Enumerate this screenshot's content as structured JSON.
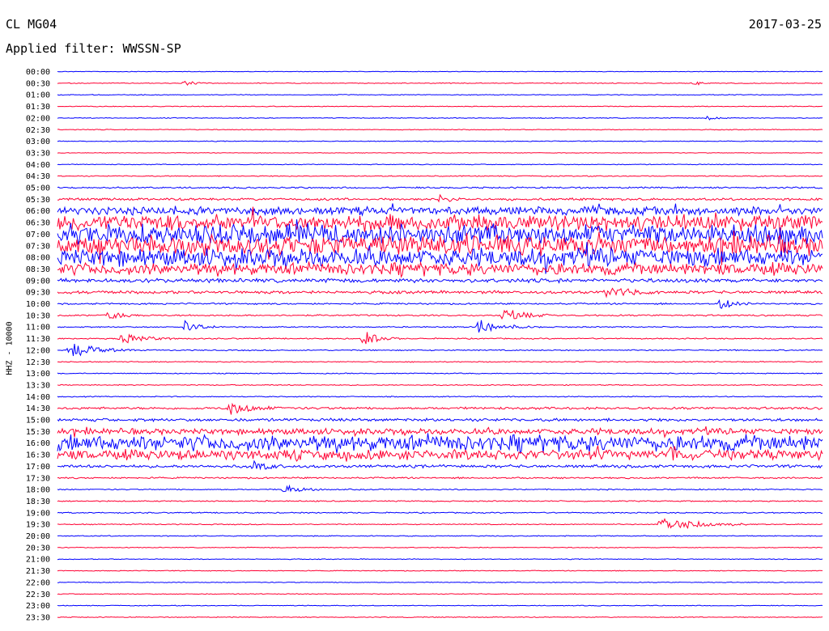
{
  "header": {
    "station": "CL MG04",
    "date": "2017-03-25",
    "filter": "Applied filter: WWSSN-SP"
  },
  "channel_label": "HHZ - 10000",
  "colors": {
    "blue": "#0000ff",
    "red": "#ff0033",
    "text": "#000000"
  },
  "chart_data": {
    "type": "line",
    "title": "",
    "ylabel": "HHZ - 10000",
    "rows": [
      "00:00",
      "00:30",
      "01:00",
      "01:30",
      "02:00",
      "02:30",
      "03:00",
      "03:30",
      "04:00",
      "04:30",
      "05:00",
      "05:30",
      "06:00",
      "06:30",
      "07:00",
      "07:30",
      "08:00",
      "08:30",
      "09:00",
      "09:30",
      "10:00",
      "10:30",
      "11:00",
      "11:30",
      "12:00",
      "12:30",
      "13:00",
      "13:30",
      "14:00",
      "14:30",
      "15:00",
      "15:30",
      "16:00",
      "16:30",
      "17:00",
      "17:30",
      "18:00",
      "18:30",
      "19:00",
      "19:30",
      "20:00",
      "20:30",
      "21:00",
      "21:30",
      "22:00",
      "22:30",
      "23:00",
      "23:30"
    ],
    "row_colors": "alternating blue (full hours) / red (half hours)",
    "noise_level": [
      0.3,
      0.4,
      0.4,
      0.4,
      0.4,
      0.4,
      0.4,
      0.3,
      0.4,
      0.5,
      0.8,
      1.2,
      4,
      8,
      10,
      10,
      9,
      6,
      2,
      1.5,
      0.8,
      0.8,
      0.6,
      0.6,
      0.6,
      0.5,
      0.5,
      0.5,
      0.5,
      1.2,
      1.5,
      3,
      8,
      5,
      1.5,
      0.8,
      0.6,
      0.6,
      0.6,
      0.5,
      0.5,
      0.4,
      0.4,
      0.4,
      0.4,
      0.4,
      0.4,
      0.4
    ],
    "events": [
      {
        "row": "00:30",
        "minute": 5.0,
        "amp": 4,
        "dur": 1.2
      },
      {
        "row": "00:30",
        "minute": 25.0,
        "amp": 3,
        "dur": 0.6
      },
      {
        "row": "02:00",
        "minute": 25.5,
        "amp": 3,
        "dur": 0.8
      },
      {
        "row": "05:30",
        "minute": 15.0,
        "amp": 6,
        "dur": 1.0
      },
      {
        "row": "09:30",
        "minute": 21.5,
        "amp": 8,
        "dur": 2.5
      },
      {
        "row": "10:00",
        "minute": 26.0,
        "amp": 10,
        "dur": 1.2
      },
      {
        "row": "10:30",
        "minute": 2.0,
        "amp": 7,
        "dur": 1.5
      },
      {
        "row": "10:30",
        "minute": 17.5,
        "amp": 10,
        "dur": 2.0
      },
      {
        "row": "11:00",
        "minute": 5.0,
        "amp": 9,
        "dur": 1.5
      },
      {
        "row": "11:00",
        "minute": 16.5,
        "amp": 10,
        "dur": 2.5
      },
      {
        "row": "11:30",
        "minute": 2.5,
        "amp": 8,
        "dur": 2.5
      },
      {
        "row": "11:30",
        "minute": 12.0,
        "amp": 11,
        "dur": 1.5
      },
      {
        "row": "12:00",
        "minute": 0.5,
        "amp": 12,
        "dur": 2.5
      },
      {
        "row": "14:30",
        "minute": 6.8,
        "amp": 10,
        "dur": 2.0
      },
      {
        "row": "16:30",
        "minute": 24.0,
        "amp": 14,
        "dur": 1.0
      },
      {
        "row": "17:00",
        "minute": 7.7,
        "amp": 8,
        "dur": 1.2
      },
      {
        "row": "18:00",
        "minute": 8.9,
        "amp": 8,
        "dur": 1.5
      },
      {
        "row": "19:30",
        "minute": 23.6,
        "amp": 13,
        "dur": 3.5
      }
    ]
  }
}
